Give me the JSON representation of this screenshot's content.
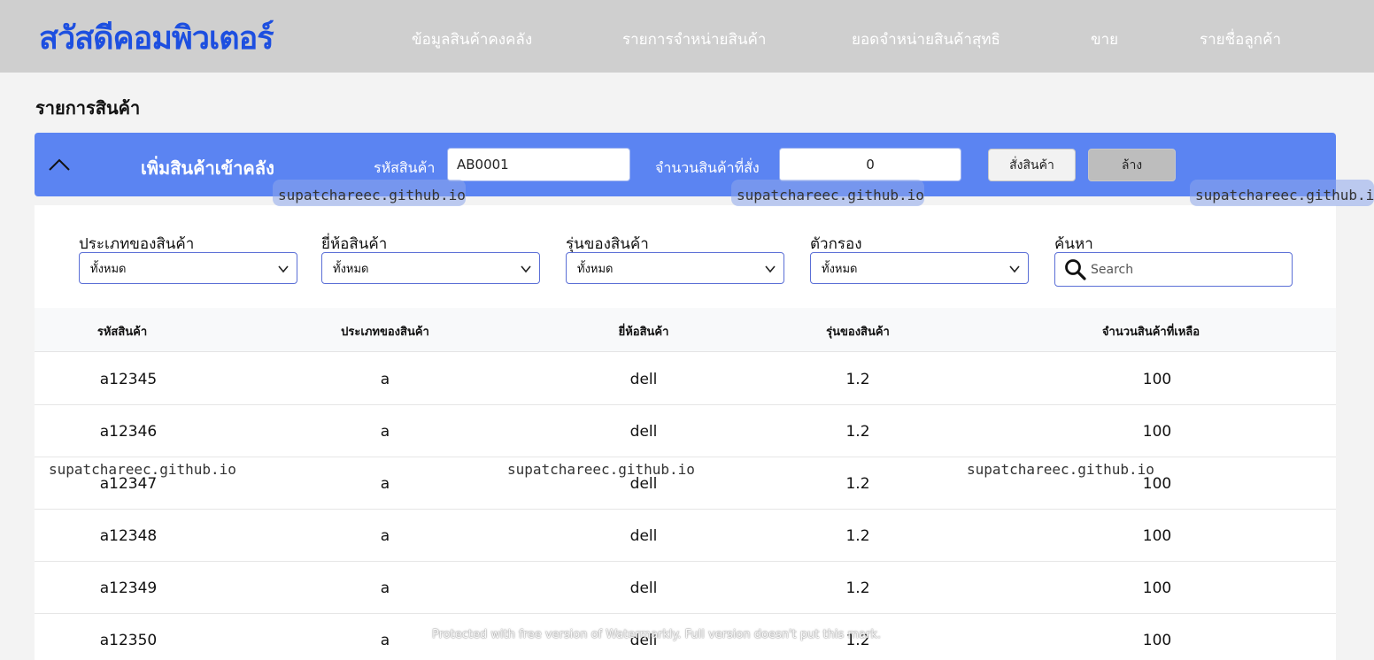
{
  "brand": {
    "logo": "สวัสดีคอมพิวเตอร์",
    "logo_color": "#1d4fe0"
  },
  "nav": {
    "items": [
      {
        "label": "ข้อมูลสินค้าคงคลัง"
      },
      {
        "label": "รายการจำหน่ายสินค้า"
      },
      {
        "label": "ยอดจำหน่ายสินค้าสุทธิ"
      },
      {
        "label": "ขาย"
      },
      {
        "label": "รายชื่อลูกค้า"
      }
    ]
  },
  "page": {
    "title": "รายการสินค้า"
  },
  "add_stock": {
    "title": "เพิ่มสินค้าเข้าคลัง",
    "code_label": "รหัสสินค้า",
    "code_value": "AB0001",
    "qty_label": "จำนวนสินค้าที่สั่ง",
    "qty_value": "0",
    "order_button": "สั่งสินค้า",
    "clear_button": "ล้าง",
    "bar_color": "#5b84f2"
  },
  "filters": {
    "type": {
      "label": "ประเภทของสินค้า",
      "selected": "ทั้งหมด"
    },
    "brand": {
      "label": "ยี่ห้อสินค้า",
      "selected": "ทั้งหมด"
    },
    "model": {
      "label": "รุ่นของสินค้า",
      "selected": "ทั้งหมด"
    },
    "filter": {
      "label": "ตัวกรอง",
      "selected": "ทั้งหมด"
    },
    "search": {
      "label": "ค้นหา",
      "placeholder": "Search"
    }
  },
  "table": {
    "headers": [
      "รหัสสินค้า",
      "ประเภทของสินค้า",
      "ยี่ห้อสินค้า",
      "รุ่นของสินค้า",
      "จำนวนสินค้าที่เหลือ"
    ],
    "rows": [
      [
        "a12345",
        "a",
        "dell",
        "1.2",
        "100"
      ],
      [
        "a12346",
        "a",
        "dell",
        "1.2",
        "100"
      ],
      [
        "a12347",
        "a",
        "dell",
        "1.2",
        "100"
      ],
      [
        "a12348",
        "a",
        "dell",
        "1.2",
        "100"
      ],
      [
        "a12349",
        "a",
        "dell",
        "1.2",
        "100"
      ],
      [
        "a12350",
        "a",
        "dell",
        "1.2",
        "100"
      ]
    ]
  },
  "watermark": {
    "text": "supatchareec.github.io",
    "footer": "Protected with free version of Watermarkly. Full version doesn't put this mark."
  }
}
